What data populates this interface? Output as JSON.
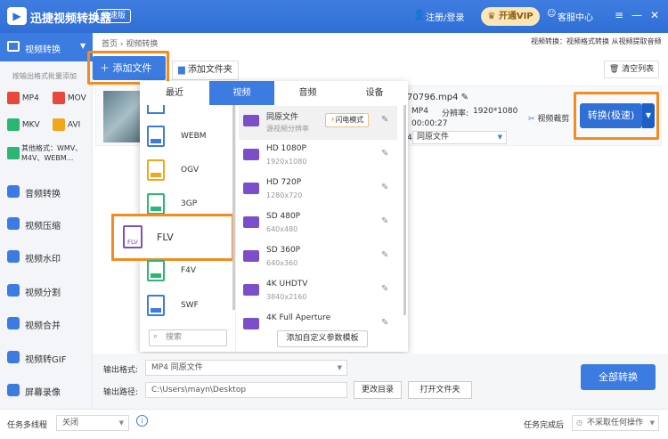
{
  "app": {
    "title": "迅捷视频转换器",
    "edition_badge": "极速版",
    "login": "注册/登录",
    "vip": "开通VIP",
    "service": "客服中心"
  },
  "sidebar": {
    "active": "视频转换",
    "note": "按输出格式批量添加",
    "formats": [
      "MP4",
      "MOV",
      "MKV",
      "AVI"
    ],
    "other_formats": "其他格式：WMV、M4V、WEBM...",
    "items": [
      {
        "label": "音频转换",
        "icon": "music-icon"
      },
      {
        "label": "视频压缩",
        "icon": "compress-icon"
      },
      {
        "label": "视频水印",
        "icon": "watermark-icon"
      },
      {
        "label": "视频分割",
        "icon": "split-icon"
      },
      {
        "label": "视频合并",
        "icon": "merge-icon"
      },
      {
        "label": "视频转GIF",
        "icon": "gif-icon"
      },
      {
        "label": "屏幕录像",
        "icon": "record-icon"
      }
    ]
  },
  "breadcrumb": {
    "home": "首页",
    "sep": "›",
    "current": "视频转换"
  },
  "header_note": "视频转换：视频格式转换 从视频提取音频",
  "toolbar": {
    "add_file": "添加文件",
    "add_folder": "添加文件夹",
    "clear_list": "清空列表"
  },
  "file": {
    "name": "70796.mp4",
    "format": "MP4",
    "resolution_label": "分辨率:",
    "resolution": "1920*1080",
    "duration": "00:00:27",
    "output_prefix": "4",
    "output_value": "同原文件",
    "trim": "视频裁剪",
    "convert": "转换(极速)"
  },
  "popup": {
    "tabs": [
      "最近",
      "视频",
      "音频",
      "设备"
    ],
    "active_tab": "视频",
    "formats": [
      {
        "label": "WEBM",
        "color": "#3c7be0"
      },
      {
        "label": "OGV",
        "color": "#f0a81a"
      },
      {
        "label": "3GP",
        "color": "#2bb673"
      },
      {
        "label": "FLV",
        "color": "#7b4fc9"
      },
      {
        "label": "F4V",
        "color": "#2bb673"
      },
      {
        "label": "SWF",
        "color": "#3c7be0"
      }
    ],
    "search_placeholder": "搜索",
    "qualities": [
      {
        "name": "同原文件",
        "res": "源视频分辨率"
      },
      {
        "name": "HD 1080P",
        "res": "1920x1080"
      },
      {
        "name": "HD 720P",
        "res": "1280x720"
      },
      {
        "name": "SD 480P",
        "res": "640x480"
      },
      {
        "name": "SD 360P",
        "res": "640x360"
      },
      {
        "name": "4K UHDTV",
        "res": "3840x2160"
      },
      {
        "name": "4K Full Aperture",
        "res": ""
      }
    ],
    "flash_mode": "闪电模式",
    "custom_template": "添加自定义参数模板"
  },
  "bottom": {
    "output_format_label": "输出格式:",
    "output_format": "MP4  同原文件",
    "output_path_label": "输出路径:",
    "output_path": "C:\\Users\\mayn\\Desktop",
    "change_dir": "更改目录",
    "open_folder": "打开文件夹",
    "convert_all": "全部转换"
  },
  "statusbar": {
    "multithread_label": "任务多线程",
    "multithread_value": "关闭",
    "after_done_label": "任务完成后",
    "after_done_value": "不采取任何操作"
  },
  "colors": {
    "accent": "#3c7be0",
    "highlight": "#f58a1f"
  }
}
